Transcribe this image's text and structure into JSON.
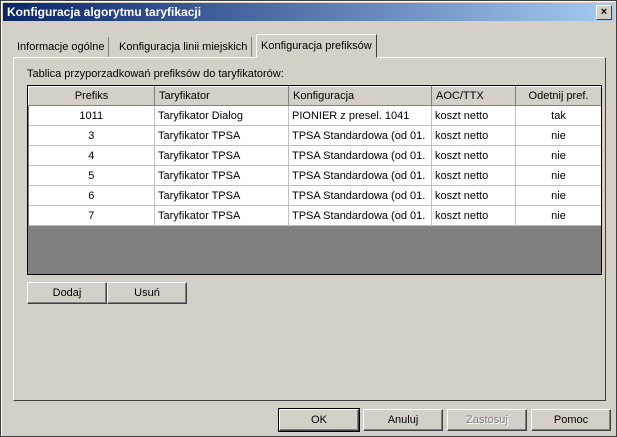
{
  "window": {
    "title": "Konfiguracja algorytmu taryfikacji",
    "close_glyph": "×"
  },
  "tabs": [
    {
      "label": "Informacje ogólne"
    },
    {
      "label": "Konfiguracja linii miejskich"
    },
    {
      "label": "Konfiguracja prefiksów",
      "active": true
    }
  ],
  "table": {
    "label": "Tablica przyporzadkowań prefiksów do taryfikatorów:",
    "columns": [
      "Prefiks",
      "Taryfikator",
      "Konfiguracja",
      "AOC/TTX",
      "Odetnij pref."
    ],
    "rows": [
      [
        "1011",
        "Taryfikator Dialog",
        "PIONIER z presel. 1041",
        "koszt netto",
        "tak"
      ],
      [
        "3",
        "Taryfikator TPSA",
        "TPSA Standardowa (od 01.",
        "koszt netto",
        "nie"
      ],
      [
        "4",
        "Taryfikator TPSA",
        "TPSA Standardowa (od 01.",
        "koszt netto",
        "nie"
      ],
      [
        "5",
        "Taryfikator TPSA",
        "TPSA Standardowa (od 01.",
        "koszt netto",
        "nie"
      ],
      [
        "6",
        "Taryfikator TPSA",
        "TPSA Standardowa (od 01.",
        "koszt netto",
        "nie"
      ],
      [
        "7",
        "Taryfikator TPSA",
        "TPSA Standardowa (od 01.",
        "koszt netto",
        "nie"
      ]
    ]
  },
  "buttons": {
    "add": "Dodaj",
    "remove": "Usuń",
    "ok": "OK",
    "cancel": "Anuluj",
    "apply": "Zastosuj",
    "help": "Pomoc"
  }
}
